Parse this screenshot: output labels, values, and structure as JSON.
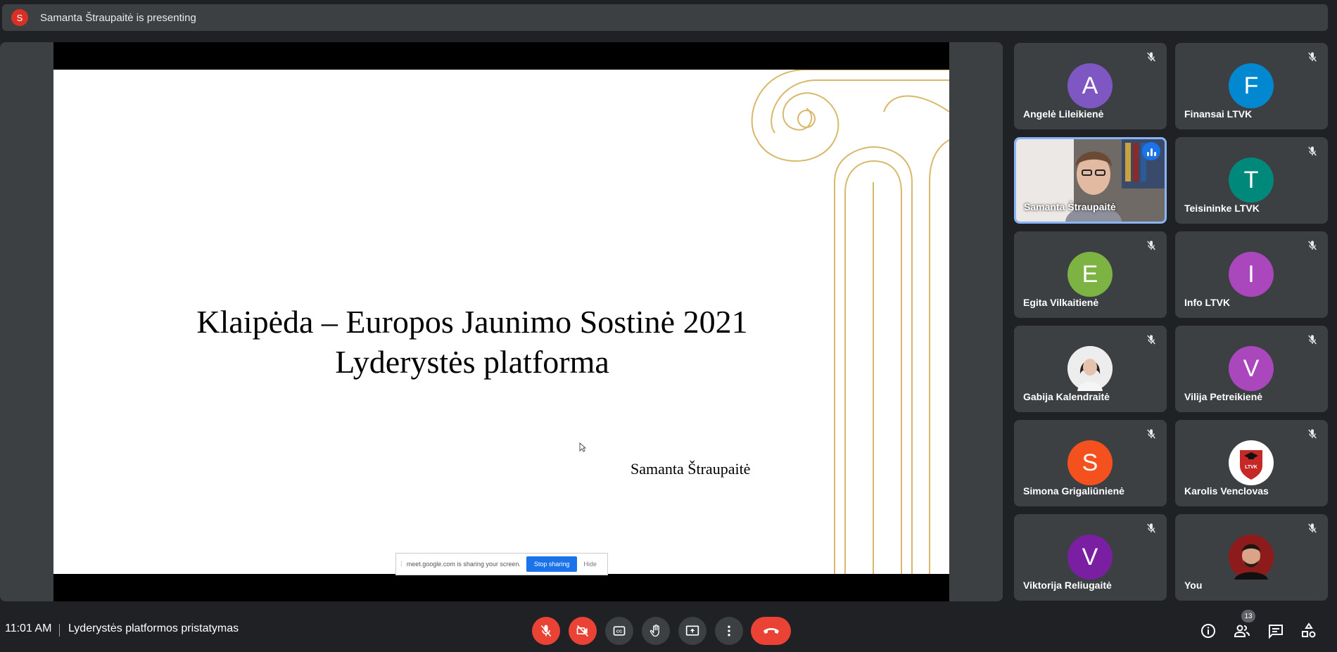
{
  "presenting_bar": {
    "avatar_letter": "S",
    "text": "Samanta Štraupaitė is presenting"
  },
  "slide": {
    "title_line1": "Klaipėda – Europos Jaunimo Sostinė 2021",
    "title_line2": "Lyderystės platforma",
    "author": "Samanta Štraupaitė"
  },
  "share_notice": {
    "text": "meet.google.com is sharing your screen.",
    "stop_label": "Stop sharing",
    "hide_label": "Hide"
  },
  "participants": [
    {
      "name": "Angelė Lileikienė",
      "letter": "A",
      "color": "#7e57c2"
    },
    {
      "name": "Finansai LTVK",
      "letter": "F",
      "color": "#0288d1"
    },
    {
      "name": "Samanta Štraupaitė",
      "letter": "",
      "color": "",
      "video": true
    },
    {
      "name": "Teisininke LTVK",
      "letter": "T",
      "color": "#00897b"
    },
    {
      "name": "Egita Vilkaitienė",
      "letter": "E",
      "color": "#7cb342"
    },
    {
      "name": "Info LTVK",
      "letter": "I",
      "color": "#ab47bc"
    },
    {
      "name": "Gabija Kalendraitė",
      "letter": "",
      "color": "#e0e0e0",
      "photo": true
    },
    {
      "name": "Vilija Petreikienė",
      "letter": "V",
      "color": "#ab47bc"
    },
    {
      "name": "Simona Grigaliūnienė",
      "letter": "S",
      "color": "#f4511e"
    },
    {
      "name": "Karolis Venclovas",
      "letter": "",
      "color": "#ffffff",
      "logo_text": "LTVK"
    },
    {
      "name": "Viktorija Reliugaitė",
      "letter": "V",
      "color": "#7b1fa2"
    },
    {
      "name": "You",
      "letter": "",
      "color": "#b71c1c",
      "photo": true
    }
  ],
  "bottom": {
    "time": "11:01 AM",
    "meeting_title": "Lyderystės platformos pristatymas",
    "participant_count": "13"
  },
  "icons": {
    "mic": "mic-off-icon",
    "camera": "videocam-off-icon",
    "captions": "closed-caption-icon",
    "hand": "raise-hand-icon",
    "present": "present-screen-icon",
    "more": "more-vert-icon",
    "end": "call-end-icon",
    "info": "info-icon",
    "people": "people-icon",
    "chat": "chat-icon",
    "activities": "activities-icon"
  }
}
